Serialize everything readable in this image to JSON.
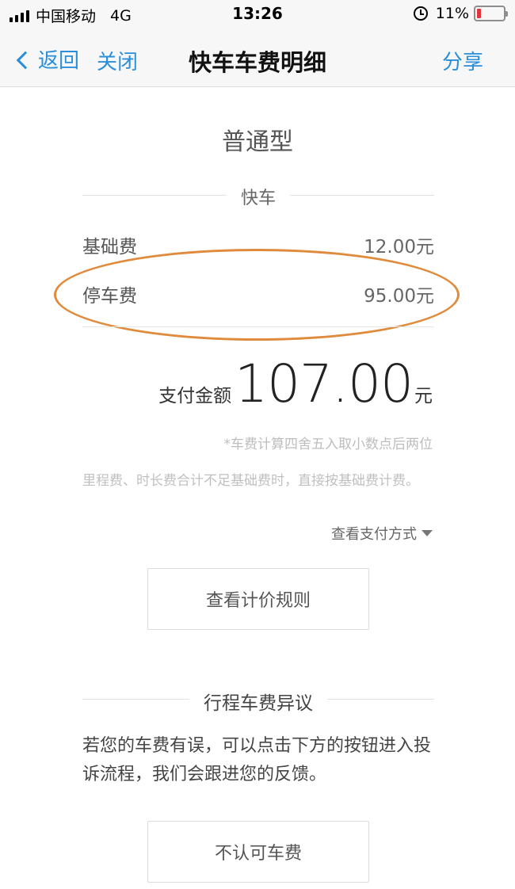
{
  "status_bar": {
    "carrier": "中国移动",
    "network": "4G",
    "time": "13:26",
    "battery": "11%",
    "battery_color": "#e0343a"
  },
  "nav": {
    "back_label": "返回",
    "close_label": "关闭",
    "title": "快车车费明细",
    "share_label": "分享",
    "accent_color": "#2a8fd8"
  },
  "trip": {
    "car_type": "普通型",
    "service": "快车"
  },
  "fees": [
    {
      "name": "基础费",
      "amount": "12.00元"
    },
    {
      "name": "停车费",
      "amount": "95.00元"
    }
  ],
  "highlight_color": "#e08a3c",
  "total": {
    "label": "支付金额",
    "value": "107.00",
    "unit": "元"
  },
  "notes": {
    "rounding": "*车费计算四舍五入取小数点后两位",
    "rule": "里程费、时长费合计不足基础费时，直接按基础费计费。"
  },
  "actions": {
    "view_payment_method": "查看支付方式",
    "view_pricing_rules": "查看计价规则"
  },
  "dispute": {
    "section_title": "行程车费异议",
    "description": "若您的车费有误，可以点击下方的按钮进入投诉流程，我们会跟进您的反馈。",
    "button_label": "不认可车费"
  }
}
